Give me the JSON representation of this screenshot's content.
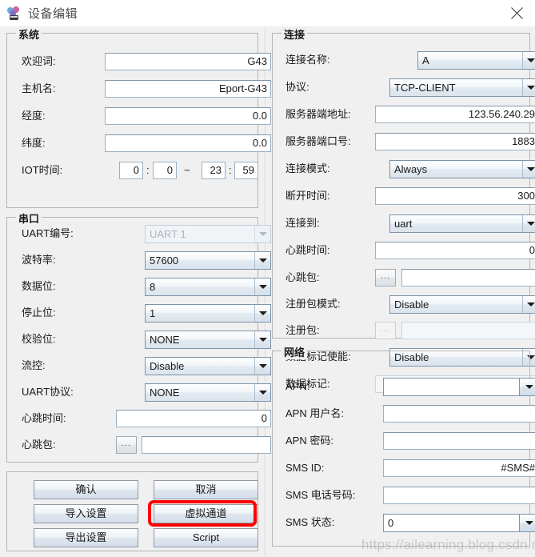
{
  "window": {
    "title": "设备编辑",
    "icon": "app-icon",
    "close_label": "×"
  },
  "left": {
    "system": {
      "legend": "系统",
      "fields": [
        {
          "label": "欢迎词:",
          "value": "G43"
        },
        {
          "label": "主机名:",
          "value": "Eport-G43"
        },
        {
          "label": "经度:",
          "value": "0.0"
        },
        {
          "label": "纬度:",
          "value": "0.0"
        }
      ],
      "iot": {
        "label": "IOT时间:",
        "start_hour": "0",
        "start_min": "0",
        "range_sep": "~",
        "end_hour": "23",
        "end_min": "59",
        "colon": ":"
      }
    },
    "serial": {
      "legend": "串口",
      "uart_no": {
        "label": "UART编号:",
        "value": "UART 1"
      },
      "baudrate": {
        "label": "波特率:",
        "value": "57600"
      },
      "databits": {
        "label": "数据位:",
        "value": "8"
      },
      "stopbits": {
        "label": "停止位:",
        "value": "1"
      },
      "parity": {
        "label": "校验位:",
        "value": "NONE"
      },
      "flowctrl": {
        "label": "流控:",
        "value": "Disable"
      },
      "uartproto": {
        "label": "UART协议:",
        "value": "NONE"
      },
      "hb_time": {
        "label": "心跳时间:",
        "value": "0"
      },
      "hb_pkt": {
        "label": "心跳包:",
        "value": "",
        "browse": "..."
      }
    }
  },
  "right": {
    "connection": {
      "legend": "连接",
      "conn_name": {
        "label": "连接名称:",
        "value": "A"
      },
      "protocol": {
        "label": "协议:",
        "value": "TCP-CLIENT"
      },
      "server_addr": {
        "label": "服务器端地址:",
        "value": "123.56.240.29"
      },
      "server_port": {
        "label": "服务器端口号:",
        "value": "1883"
      },
      "conn_mode": {
        "label": "连接模式:",
        "value": "Always"
      },
      "disc_time": {
        "label": "断开时间:",
        "value": "300"
      },
      "connect_to": {
        "label": "连接到:",
        "value": "uart"
      },
      "hb_time": {
        "label": "心跳时间:",
        "value": "0"
      },
      "hb_pkt": {
        "label": "心跳包:",
        "value": "",
        "browse": "..."
      },
      "reg_mode": {
        "label": "注册包模式:",
        "value": "Disable"
      },
      "reg_pkt": {
        "label": "注册包:",
        "value": "",
        "browse": "..."
      },
      "datamark_en": {
        "label": "数据标记使能:",
        "value": "Disable"
      },
      "datamark": {
        "label": "数据标记:",
        "value": ""
      }
    },
    "network": {
      "legend": "网络",
      "apn": {
        "label": "APN:",
        "value": ""
      },
      "apn_user": {
        "label": "APN 用户名:",
        "value": ""
      },
      "apn_pass": {
        "label": "APN 密码:",
        "value": ""
      },
      "sms_id": {
        "label": "SMS ID:",
        "value": "#SMS#"
      },
      "sms_phone": {
        "label": "SMS 电话号码:",
        "value": ""
      },
      "sms_state": {
        "label": "SMS 状态:",
        "value": "0"
      }
    }
  },
  "buttons": {
    "confirm": "确认",
    "cancel": "取消",
    "import": "导入设置",
    "virtual_channel": "虚拟通道",
    "export": "导出设置",
    "script": "Script"
  },
  "annotation": {
    "highlight_target": "虚拟通道",
    "highlight_color": "#fe0000"
  },
  "watermark": "https://ailearning.blog.csdn.net"
}
